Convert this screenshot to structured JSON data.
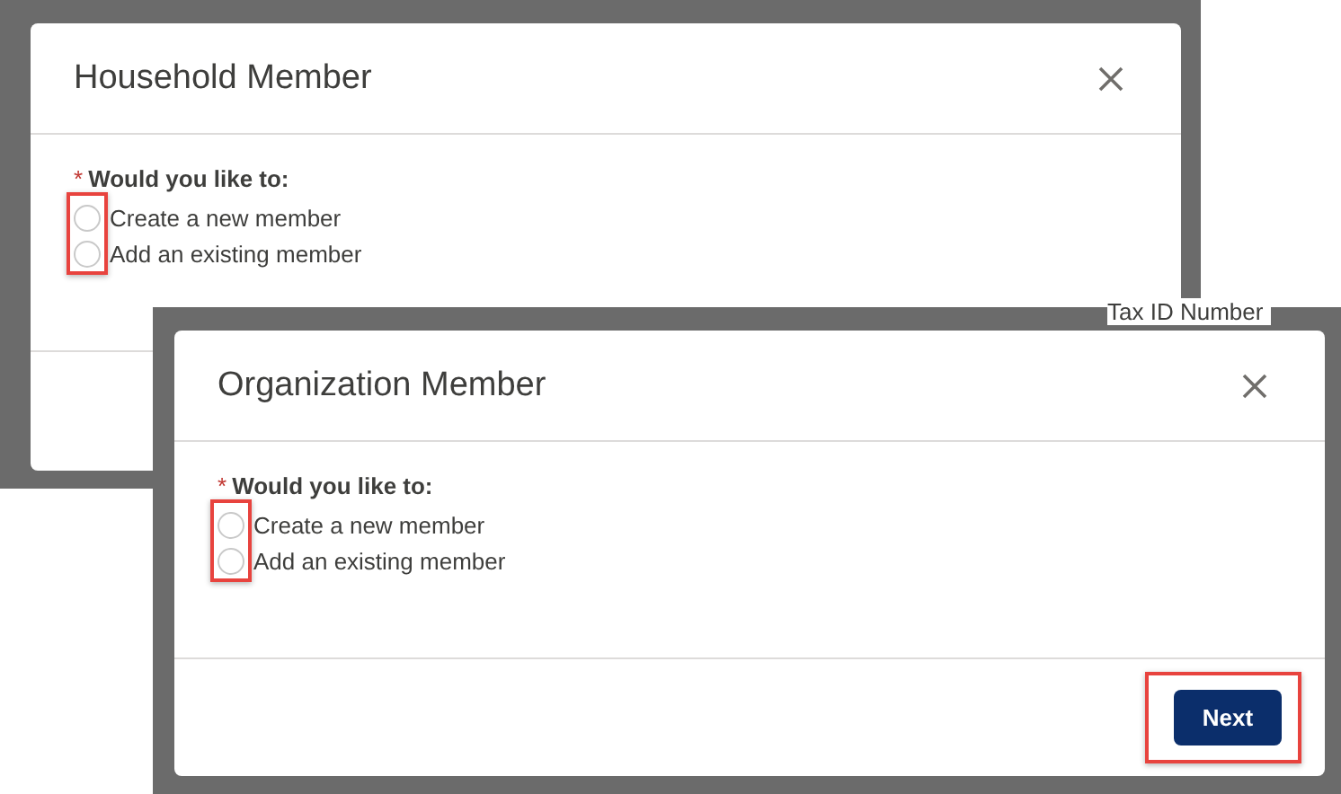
{
  "screens": [
    {
      "title": "Household Member",
      "required_mark": "*",
      "question": "Would you like to:",
      "options": [
        {
          "label": "Create a new member",
          "selected": false
        },
        {
          "label": "Add an existing member",
          "selected": false
        }
      ],
      "options_highlighted": true
    },
    {
      "title": "Organization Member",
      "required_mark": "*",
      "question": "Would you like to:",
      "options": [
        {
          "label": "Create a new member",
          "selected": false
        },
        {
          "label": "Add an existing member",
          "selected": false
        }
      ],
      "options_highlighted": true,
      "buttons": [
        {
          "label": "Next",
          "highlighted": true
        }
      ]
    }
  ],
  "background_label": "Tax ID Number"
}
